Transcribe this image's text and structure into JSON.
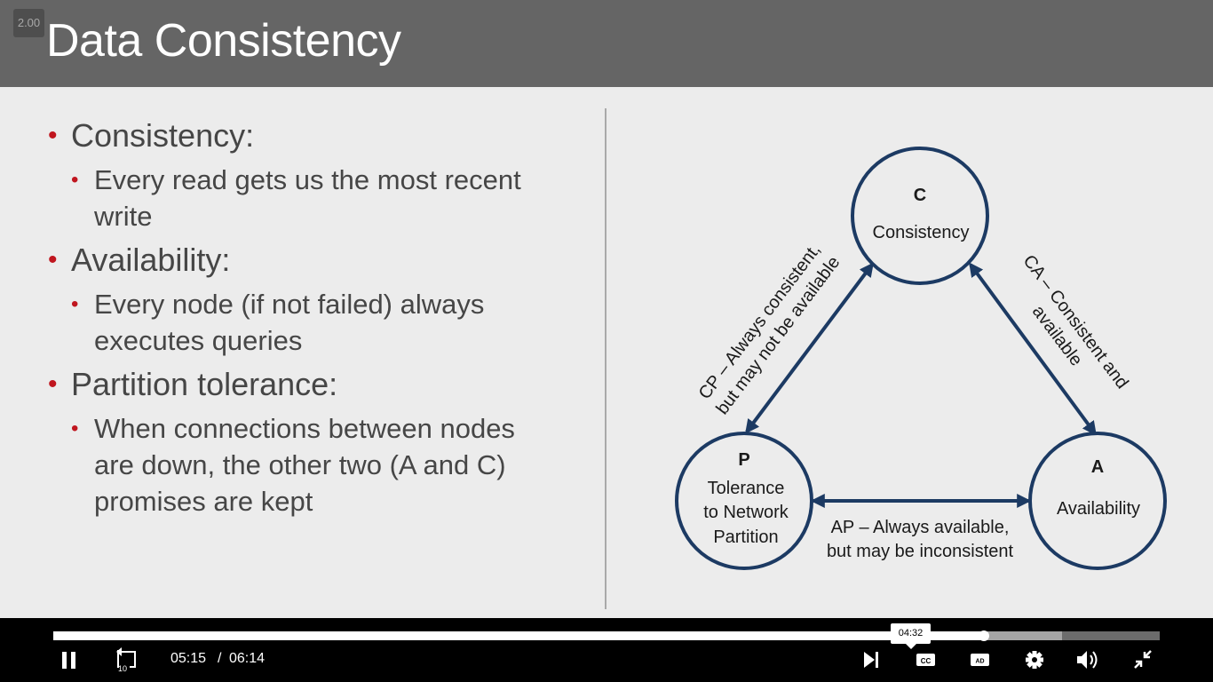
{
  "slide": {
    "speed_badge": "2.00",
    "title": "Data Consistency",
    "bullets": [
      {
        "heading": "Consistency:",
        "detail": [
          "Every read gets us the most recent",
          "write"
        ]
      },
      {
        "heading": "Availability:",
        "detail": [
          "Every node (if not failed) always",
          "executes queries"
        ]
      },
      {
        "heading": "Partition tolerance:",
        "detail": [
          "When connections between nodes",
          "are down, the other two (A and C)",
          "promises are kept"
        ]
      }
    ],
    "diagram": {
      "c_node": {
        "letter": "C",
        "name": "Consistency"
      },
      "a_node": {
        "letter": "A",
        "name": "Availability"
      },
      "p_node": {
        "letter": "P",
        "name_lines": [
          "Tolerance",
          "to Network",
          "Partition"
        ]
      },
      "cp_label": [
        "CP – Always consistent,",
        "but may not be available"
      ],
      "ca_label": [
        "CA – Consistent and",
        "available"
      ],
      "ap_label": [
        "AP – Always available,",
        "but may be inconsistent"
      ],
      "circle_color": "#1c3a63"
    }
  },
  "player": {
    "current_time": "05:15",
    "separator": "/",
    "total_time": "06:14",
    "hover_time": "04:32",
    "played_fraction": 0.8411,
    "buffered_fraction": 0.9117,
    "replay_seconds": "10",
    "colors": {
      "played": "#ffffff",
      "buffered": "#a5a5a5",
      "track": "#6c6c6c"
    }
  }
}
